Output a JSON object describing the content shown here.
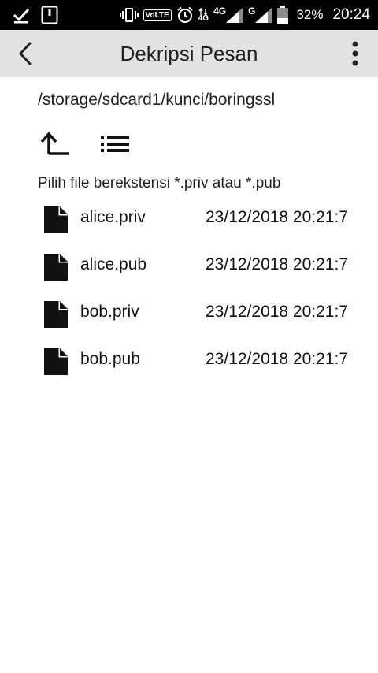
{
  "status_bar": {
    "volte": "VoLTE",
    "net_primary": "4G",
    "net_secondary": "G",
    "battery_percent": "32%",
    "time": "20:24",
    "icons": [
      "check-download-icon",
      "sim-card-icon",
      "vibrate-icon",
      "volte-icon",
      "alarm-icon",
      "data-arrows-icon",
      "signal-icon",
      "battery-icon"
    ]
  },
  "toolbar": {
    "title": "Dekripsi Pesan",
    "back_icon": "chevron-left-icon",
    "more_icon": "more-vert-icon"
  },
  "browser": {
    "path": "/storage/sdcard1/kunci/boringssl",
    "hint": "Pilih file berekstensi *.priv atau *.pub",
    "up_icon": "folder-up-icon",
    "list_icon": "list-view-icon"
  },
  "files": [
    {
      "name": "alice.priv",
      "date": "23/12/2018 20:21:7",
      "icon": "file-icon"
    },
    {
      "name": "alice.pub",
      "date": "23/12/2018 20:21:7",
      "icon": "file-icon"
    },
    {
      "name": "bob.priv",
      "date": "23/12/2018 20:21:7",
      "icon": "file-icon"
    },
    {
      "name": "bob.pub",
      "date": "23/12/2018 20:21:7",
      "icon": "file-icon"
    }
  ],
  "colors": {
    "status_bar": "#000000",
    "toolbar": "#e2e2e2",
    "text": "#222222"
  }
}
